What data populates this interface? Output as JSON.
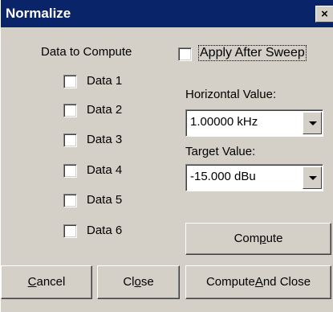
{
  "window": {
    "title": "Normalize",
    "close_glyph": "×"
  },
  "data_group": {
    "label": "Data to Compute",
    "items": [
      {
        "label": "Data 1",
        "checked": false
      },
      {
        "label": "Data 2",
        "checked": false
      },
      {
        "label": "Data 3",
        "checked": false
      },
      {
        "label": "Data 4",
        "checked": false
      },
      {
        "label": "Data 5",
        "checked": false
      },
      {
        "label": "Data 6",
        "checked": false
      }
    ]
  },
  "apply_after_sweep": {
    "label": "Apply After Sweep",
    "checked": false
  },
  "horizontal": {
    "label": "Horizontal Value:",
    "value": "1.00000 kHz"
  },
  "target": {
    "label": "Target Value:",
    "value": "-15.000  dBu"
  },
  "buttons": {
    "compute": {
      "pre": "Com",
      "u": "p",
      "post": "ute"
    },
    "cancel": {
      "pre": "",
      "u": "C",
      "post": "ancel"
    },
    "close": {
      "pre": "Cl",
      "u": "o",
      "post": "se"
    },
    "compute_close": {
      "pre": "Compute ",
      "u": "A",
      "post": "nd Close"
    }
  }
}
